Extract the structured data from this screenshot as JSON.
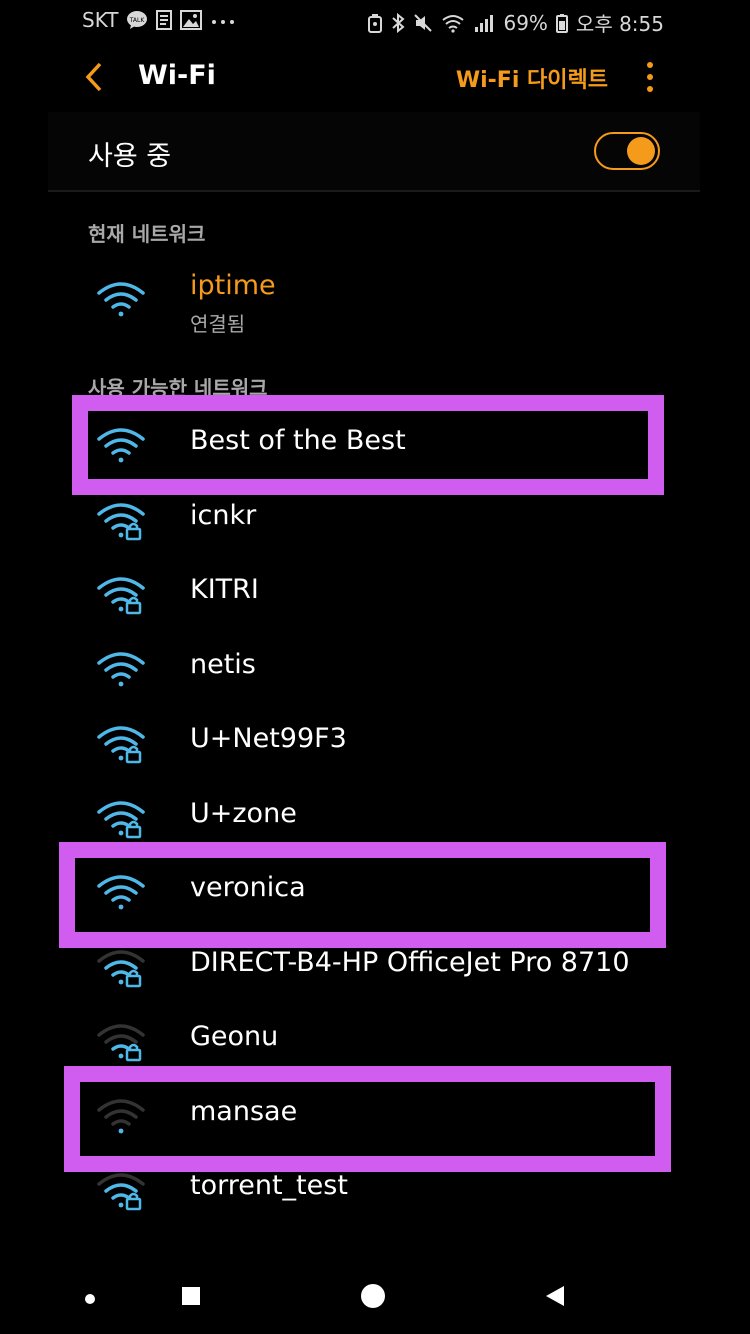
{
  "status": {
    "carrier": "SKT",
    "battery": "69%",
    "time": "오후 8:55",
    "left_icons": [
      "kakaotalk-icon",
      "memo-icon",
      "gallery-icon",
      "more-notifications-icon"
    ],
    "right_icons": [
      "alarm-icon",
      "bluetooth-icon",
      "mute-icon",
      "wifi-status-icon",
      "cell-signal-icon",
      "battery-icon"
    ]
  },
  "appbar": {
    "title": "Wi-Fi",
    "wifi_direct_label": "Wi-Fi 다이렉트"
  },
  "toggle": {
    "label": "사용 중",
    "on": true
  },
  "current_section": {
    "header": "현재 네트워크",
    "network": {
      "name": "iptime",
      "status": "연결됨"
    }
  },
  "available_section": {
    "header": "사용 가능한 네트워크",
    "networks": [
      {
        "name": "Best of the Best",
        "locked": false,
        "strength": 4
      },
      {
        "name": "icnkr",
        "locked": true,
        "strength": 4
      },
      {
        "name": "KITRI",
        "locked": true,
        "strength": 4
      },
      {
        "name": "netis",
        "locked": false,
        "strength": 4
      },
      {
        "name": "U+Net99F3",
        "locked": true,
        "strength": 4
      },
      {
        "name": "U+zone",
        "locked": true,
        "strength": 4
      },
      {
        "name": "veronica",
        "locked": false,
        "strength": 4
      },
      {
        "name": "DIRECT-B4-HP OfficeJet Pro 8710",
        "locked": true,
        "strength": 3
      },
      {
        "name": "Geonu",
        "locked": true,
        "strength": 2
      },
      {
        "name": "mansae",
        "locked": false,
        "strength": 1
      },
      {
        "name": "torrent_test",
        "locked": true,
        "strength": 3
      }
    ]
  },
  "colors": {
    "accent": "#f59b1b",
    "wifi_icon": "#4fb8e8",
    "highlight": "#d05cf0"
  }
}
